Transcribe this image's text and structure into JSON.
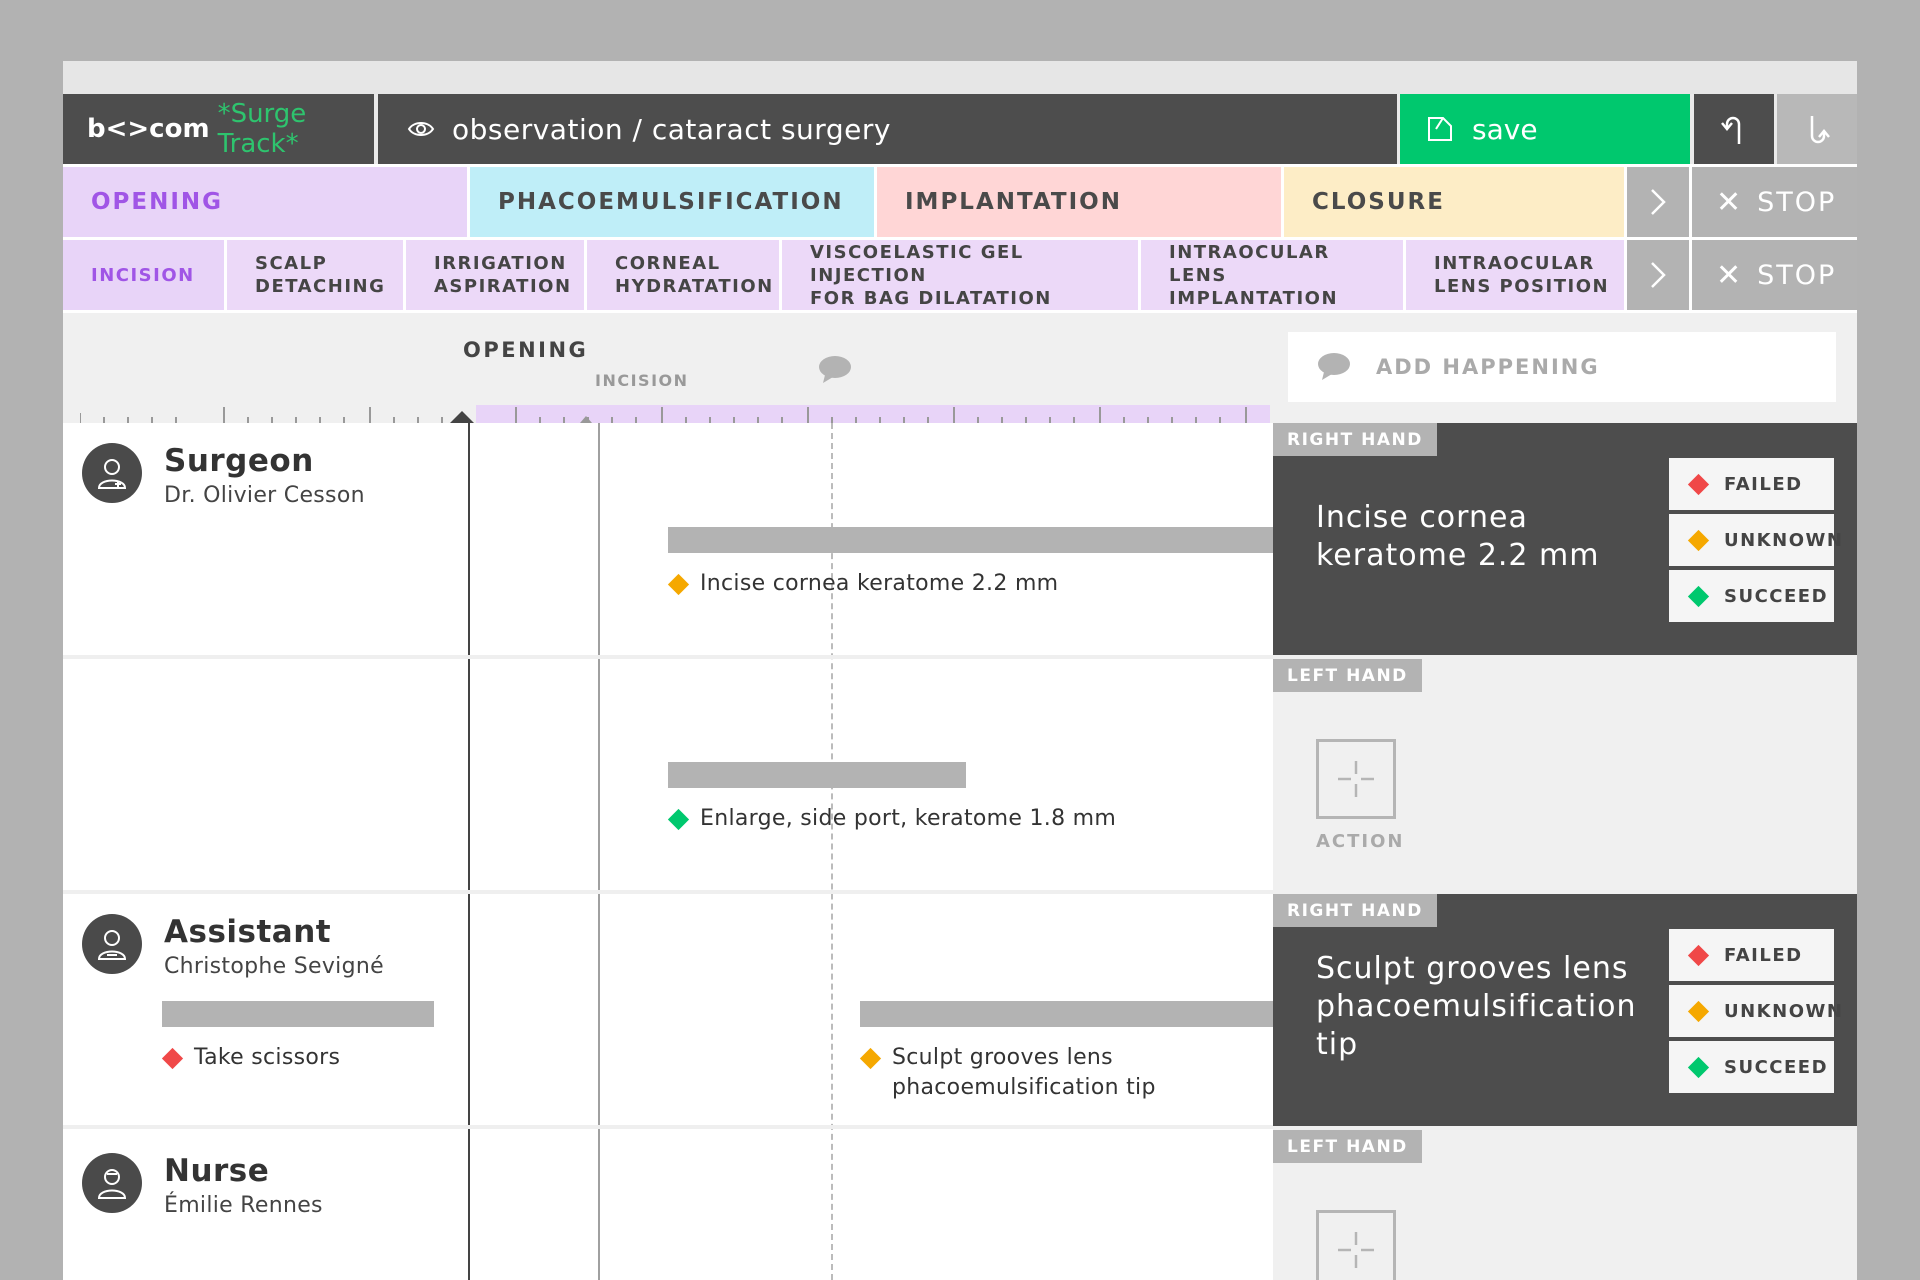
{
  "topbar": {
    "logo_brand": "b<>com",
    "logo_product": "*Surge Track*",
    "title": "observation / cataract surgery",
    "save_label": "save"
  },
  "phases": [
    {
      "label": "OPENING",
      "color": "#e8d4f8"
    },
    {
      "label": "PHACOEMULSIFICATION",
      "color": "#bfeef8"
    },
    {
      "label": "IMPLANTATION",
      "color": "#ffd6d6"
    },
    {
      "label": "CLOSURE",
      "color": "#fdedc6"
    }
  ],
  "steps": [
    {
      "label": "INCISION"
    },
    {
      "label": "SCALP\nDETACHING"
    },
    {
      "label": "IRRIGATION\nASPIRATION"
    },
    {
      "label": "CORNEAL\nHYDRATATION"
    },
    {
      "label": "VISCOELASTIC GEL INJECTION\nFOR BAG DILATATION"
    },
    {
      "label": "INTRAOCULAR\nLENS IMPLANTATION"
    },
    {
      "label": "INTRAOCULAR\nLENS POSITION"
    }
  ],
  "stop_label": "STOP",
  "timeline": {
    "phase_label": "OPENING",
    "step_label": "INCISION"
  },
  "add_happening_label": "ADD HAPPENING",
  "roles": [
    {
      "name": "Surgeon",
      "person": "Dr. Olivier Cesson"
    },
    {
      "name": "Assistant",
      "person": "Christophe Sevigné"
    },
    {
      "name": "Nurse",
      "person": "Émilie Rennes"
    }
  ],
  "events": [
    {
      "text": "Incise cornea keratome 2.2 mm",
      "status_color": "#f5a800"
    },
    {
      "text": "Enlarge, side port, keratome 1.8 mm",
      "status_color": "#00c86e"
    },
    {
      "text": "Take scissors",
      "status_color": "#f04848"
    },
    {
      "text": "Sculpt grooves lens\nphacoemulsification tip",
      "status_color": "#f5a800"
    }
  ],
  "panel": {
    "right_hand_label": "RIGHT HAND",
    "left_hand_label": "LEFT HAND",
    "action_label": "ACTION",
    "card1_text": "Incise cornea\nkeratome 2.2 mm",
    "card2_text": "Sculpt grooves lens\nphacoemulsification\ntip",
    "status": [
      {
        "label": "FAILED",
        "color": "#f04848"
      },
      {
        "label": "UNKNOWN",
        "color": "#f5a800"
      },
      {
        "label": "SUCCEED",
        "color": "#00c86e"
      }
    ]
  }
}
